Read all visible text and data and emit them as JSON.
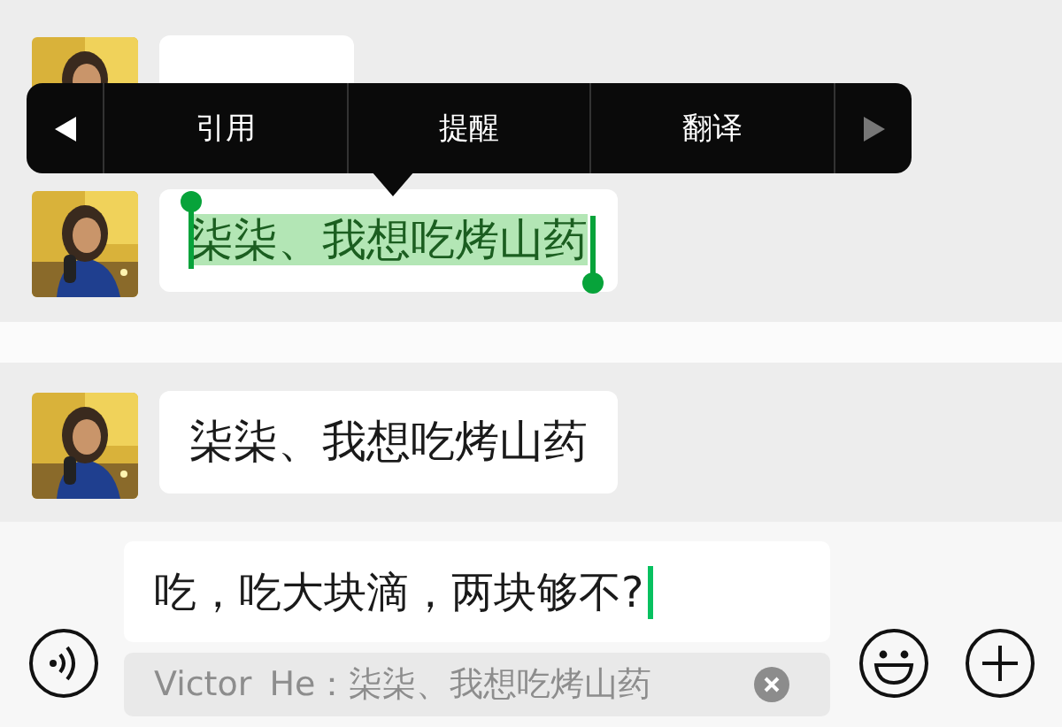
{
  "panels": [
    {
      "messages": [
        {
          "selected": false
        },
        {
          "text": "柒柒、我想吃烤山药",
          "selected": true
        }
      ],
      "context_menu": {
        "items": [
          {
            "kind": "arrow-left",
            "disabled": false
          },
          {
            "kind": "item",
            "label": "引用"
          },
          {
            "kind": "item",
            "label": "提醒"
          },
          {
            "kind": "item",
            "label": "翻译"
          },
          {
            "kind": "arrow-right",
            "disabled": true
          }
        ]
      }
    },
    {
      "messages": [
        {
          "text": "柒柒、我想吃烤山药",
          "selected": false
        }
      ]
    }
  ],
  "composer": {
    "value": "吃，吃大块滴，两块够不?",
    "quote": "Victor He：柒柒、我想吃烤山药"
  }
}
